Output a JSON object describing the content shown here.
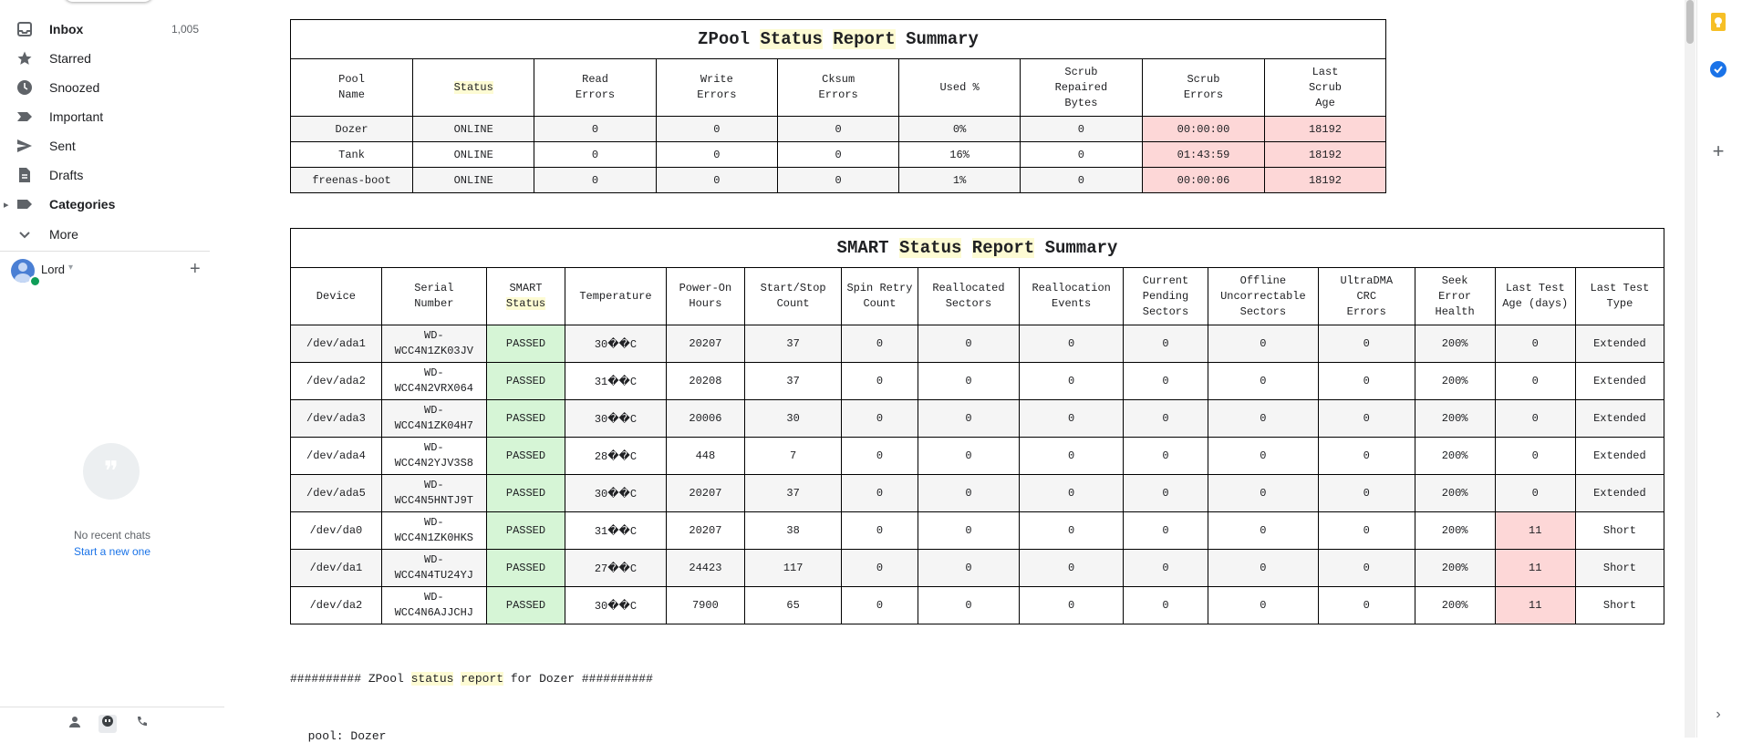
{
  "sidebar": {
    "items": [
      {
        "label": "Inbox",
        "count": "1,005",
        "icon": "inbox-icon"
      },
      {
        "label": "Starred",
        "icon": "star-icon"
      },
      {
        "label": "Snoozed",
        "icon": "clock-icon"
      },
      {
        "label": "Important",
        "icon": "important-icon"
      },
      {
        "label": "Sent",
        "icon": "send-icon"
      },
      {
        "label": "Drafts",
        "icon": "draft-icon"
      },
      {
        "label": "Categories",
        "icon": "label-icon"
      },
      {
        "label": "More",
        "icon": "chevron-down-icon"
      }
    ],
    "user": {
      "name": "Lord"
    },
    "chat": {
      "empty": "No recent chats",
      "start": "Start a new one"
    }
  },
  "zpool": {
    "title_parts": [
      "ZPool ",
      "Status",
      " ",
      "Report",
      " Summary"
    ],
    "headers": [
      [
        "Pool",
        "Name"
      ],
      [
        "Status"
      ],
      [
        "Read",
        "Errors"
      ],
      [
        "Write",
        "Errors"
      ],
      [
        "Cksum",
        "Errors"
      ],
      [
        "Used %"
      ],
      [
        "Scrub",
        "Repaired",
        "Bytes"
      ],
      [
        "Scrub",
        "Errors"
      ],
      [
        "Last",
        "Scrub",
        "Age"
      ]
    ],
    "rows": [
      [
        "Dozer",
        "ONLINE",
        "0",
        "0",
        "0",
        "0%",
        "0",
        "00:00:00",
        "18192"
      ],
      [
        "Tank",
        "ONLINE",
        "0",
        "0",
        "0",
        "16%",
        "0",
        "01:43:59",
        "18192"
      ],
      [
        "freenas-boot",
        "ONLINE",
        "0",
        "0",
        "0",
        "1%",
        "0",
        "00:00:06",
        "18192"
      ]
    ]
  },
  "smart": {
    "title_parts": [
      "SMART ",
      "Status",
      " ",
      "Report",
      " Summary"
    ],
    "headers": [
      [
        "Device"
      ],
      [
        "Serial",
        "Number"
      ],
      [
        "SMART",
        "Status"
      ],
      [
        "Temperature"
      ],
      [
        "Power-On",
        "Hours"
      ],
      [
        "Start/Stop",
        "Count"
      ],
      [
        "Spin Retry",
        "Count"
      ],
      [
        "Reallocated",
        "Sectors"
      ],
      [
        "Reallocation",
        "Events"
      ],
      [
        "Current",
        "Pending",
        "Sectors"
      ],
      [
        "Offline",
        "Uncorrectable",
        "Sectors"
      ],
      [
        "UltraDMA",
        "CRC",
        "Errors"
      ],
      [
        "Seek",
        "Error",
        "Health"
      ],
      [
        "Last Test",
        "Age (days)"
      ],
      [
        "Last Test",
        "Type"
      ]
    ],
    "rows": [
      [
        "/dev/ada1",
        "WD-WCC4N1ZK03JV",
        "PASSED",
        "30��C",
        "20207",
        "37",
        "0",
        "0",
        "0",
        "0",
        "0",
        "0",
        "200%",
        "0",
        "Extended"
      ],
      [
        "/dev/ada2",
        "WD-WCC4N2VRX064",
        "PASSED",
        "31��C",
        "20208",
        "37",
        "0",
        "0",
        "0",
        "0",
        "0",
        "0",
        "200%",
        "0",
        "Extended"
      ],
      [
        "/dev/ada3",
        "WD-WCC4N1ZK04H7",
        "PASSED",
        "30��C",
        "20006",
        "30",
        "0",
        "0",
        "0",
        "0",
        "0",
        "0",
        "200%",
        "0",
        "Extended"
      ],
      [
        "/dev/ada4",
        "WD-WCC4N2YJV3S8",
        "PASSED",
        "28��C",
        "448",
        "7",
        "0",
        "0",
        "0",
        "0",
        "0",
        "0",
        "200%",
        "0",
        "Extended"
      ],
      [
        "/dev/ada5",
        "WD-WCC4N5HNTJ9T",
        "PASSED",
        "30��C",
        "20207",
        "37",
        "0",
        "0",
        "0",
        "0",
        "0",
        "0",
        "200%",
        "0",
        "Extended"
      ],
      [
        "/dev/da0",
        "WD-WCC4N1ZK0HKS",
        "PASSED",
        "31��C",
        "20207",
        "38",
        "0",
        "0",
        "0",
        "0",
        "0",
        "0",
        "200%",
        "11",
        "Short"
      ],
      [
        "/dev/da1",
        "WD-WCC4N4TU24YJ",
        "PASSED",
        "27��C",
        "24423",
        "117",
        "0",
        "0",
        "0",
        "0",
        "0",
        "0",
        "200%",
        "11",
        "Short"
      ],
      [
        "/dev/da2",
        "WD-WCC4N6AJJCHJ",
        "PASSED",
        "30��C",
        "7900",
        "65",
        "0",
        "0",
        "0",
        "0",
        "0",
        "0",
        "200%",
        "11",
        "Short"
      ]
    ]
  },
  "report_line": {
    "parts": [
      "########## ZPool ",
      "status",
      " ",
      "report",
      " for Dozer ##########"
    ]
  },
  "pool_line": "  pool: Dozer"
}
